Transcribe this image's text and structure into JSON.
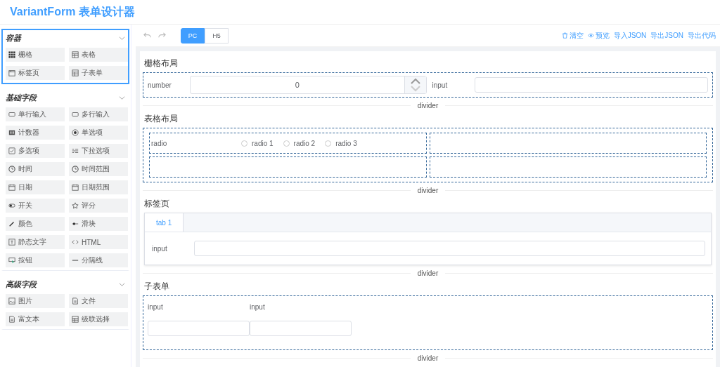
{
  "app": {
    "title": "VariantForm 表单设计器"
  },
  "widget_panel": {
    "sections": [
      {
        "title": "容器",
        "expanded": true,
        "selected": true,
        "items": [
          {
            "label": "栅格",
            "kind": "grid"
          },
          {
            "label": "表格",
            "kind": "table"
          },
          {
            "label": "标签页",
            "kind": "tab"
          },
          {
            "label": "子表单",
            "kind": "table"
          }
        ]
      },
      {
        "title": "基础字段",
        "expanded": true,
        "selected": false,
        "items": [
          {
            "label": "单行输入",
            "kind": "input"
          },
          {
            "label": "多行输入",
            "kind": "input"
          },
          {
            "label": "计数器",
            "kind": "counter"
          },
          {
            "label": "单选项",
            "kind": "radio"
          },
          {
            "label": "多选项",
            "kind": "checkbox"
          },
          {
            "label": "下拉选项",
            "kind": "list"
          },
          {
            "label": "时间",
            "kind": "clock"
          },
          {
            "label": "时间范围",
            "kind": "clock"
          },
          {
            "label": "日期",
            "kind": "calendar"
          },
          {
            "label": "日期范围",
            "kind": "calendar"
          },
          {
            "label": "开关",
            "kind": "toggle"
          },
          {
            "label": "评分",
            "kind": "star"
          },
          {
            "label": "颜色",
            "kind": "pen"
          },
          {
            "label": "滑块",
            "kind": "slider"
          },
          {
            "label": "静态文字",
            "kind": "text"
          },
          {
            "label": "HTML",
            "kind": "code"
          },
          {
            "label": "按钮",
            "kind": "button"
          },
          {
            "label": "分隔线",
            "kind": "line"
          }
        ]
      },
      {
        "title": "高级字段",
        "expanded": true,
        "selected": false,
        "items": [
          {
            "label": "图片",
            "kind": "image"
          },
          {
            "label": "文件",
            "kind": "file"
          },
          {
            "label": "富文本",
            "kind": "file"
          },
          {
            "label": "级联选择",
            "kind": "table"
          }
        ]
      }
    ]
  },
  "toolbar": {
    "device_tabs": [
      {
        "label": "PC",
        "selected": true
      },
      {
        "label": "H5",
        "selected": false
      }
    ],
    "actions": [
      {
        "label": "清空",
        "kind": "trash"
      },
      {
        "label": "预览",
        "kind": "eye"
      },
      {
        "label": "导入JSON",
        "kind": "plain"
      },
      {
        "label": "导出JSON",
        "kind": "plain"
      },
      {
        "label": "导出代码",
        "kind": "plain"
      }
    ]
  },
  "canvas": {
    "widgets": [
      {
        "kind": "grid",
        "title": "栅格布局",
        "number_label": "number",
        "number_value": "0",
        "input_label": "input"
      },
      {
        "kind": "divider",
        "label": "divider"
      },
      {
        "kind": "table",
        "title": "表格布局",
        "radio_label": "radio",
        "options": [
          {
            "label": "radio 1",
            "selected": false
          },
          {
            "label": "radio 2",
            "selected": false
          },
          {
            "label": "radio 3",
            "selected": false
          }
        ]
      },
      {
        "kind": "divider",
        "label": "divider"
      },
      {
        "kind": "tabs",
        "title": "标签页",
        "tabs": [
          {
            "label": "tab 1",
            "selected": true
          }
        ],
        "input_label": "input"
      },
      {
        "kind": "divider",
        "label": "divider"
      },
      {
        "kind": "subform",
        "title": "子表单",
        "columns": [
          "input",
          "input"
        ]
      },
      {
        "kind": "divider",
        "label": "divider"
      }
    ]
  }
}
